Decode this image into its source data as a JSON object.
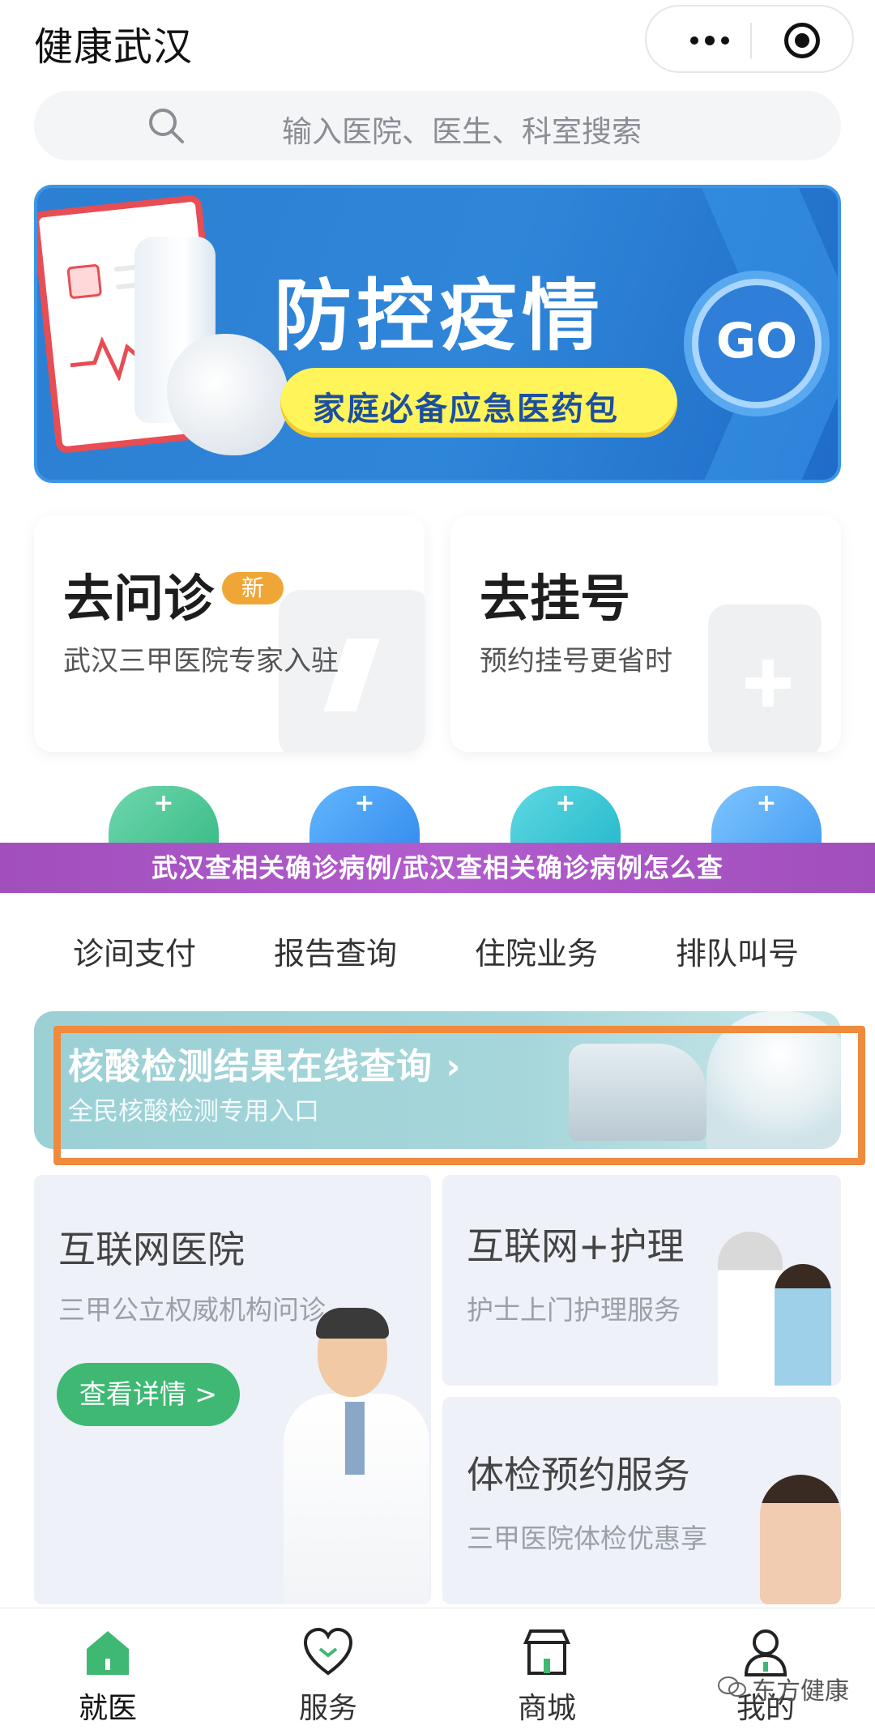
{
  "header": {
    "title": "健康武汉",
    "more_icon": "more-dots-icon",
    "close_icon": "target-circle-icon"
  },
  "search": {
    "placeholder": "输入医院、医生、科室搜索",
    "icon": "search-icon"
  },
  "banner": {
    "title": "防控疫情",
    "pill_text": "家庭必备应急医药包",
    "go_label": "GO",
    "colors": {
      "background": "#2f86d9",
      "pill": "#fff45a"
    }
  },
  "service_cards": [
    {
      "title": "去问诊",
      "badge": "新",
      "subtitle": "武汉三甲医院专家入驻"
    },
    {
      "title": "去挂号",
      "subtitle": "预约挂号更省时"
    }
  ],
  "quick_links": [
    {
      "label": "诊间支付",
      "icon": "payment-icon"
    },
    {
      "label": "报告查询",
      "icon": "report-icon"
    },
    {
      "label": "住院业务",
      "icon": "hospital-bed-icon"
    },
    {
      "label": "排队叫号",
      "icon": "queue-icon"
    }
  ],
  "overlay_caption": "武汉查相关确诊病例/武汉查相关确诊病例怎么查",
  "nucleic_banner": {
    "title": "核酸检测结果在线查询",
    "arrow": "›",
    "subtitle": "全民核酸检测专用入口",
    "highlight_color": "#f08a3c"
  },
  "features": [
    {
      "title": "互联网医院",
      "subtitle": "三甲公立权威机构问诊",
      "button": "查看详情 >"
    },
    {
      "title": "互联网+护理",
      "subtitle": "护士上门护理服务"
    },
    {
      "title": "体检预约服务",
      "subtitle": "三甲医院体检优惠享"
    }
  ],
  "tabbar": [
    {
      "label": "就医",
      "icon": "home-icon",
      "active": true
    },
    {
      "label": "服务",
      "icon": "heart-icon",
      "active": false
    },
    {
      "label": "商城",
      "icon": "store-icon",
      "active": false
    },
    {
      "label": "我的",
      "icon": "user-icon",
      "active": false
    }
  ],
  "watermark": "东方健康",
  "colors": {
    "accent_green": "#3fb873",
    "text_dark": "#111111"
  }
}
